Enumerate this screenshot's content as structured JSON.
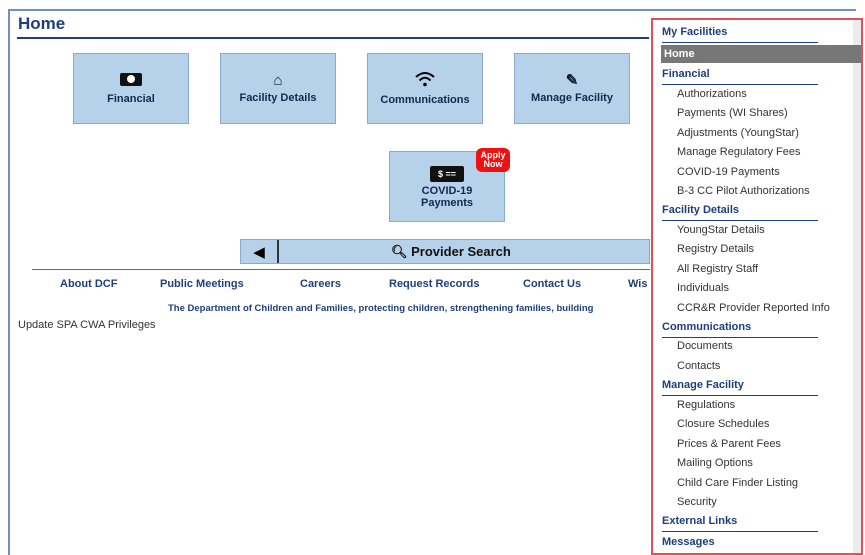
{
  "page": {
    "title": "Home"
  },
  "tiles": {
    "financial": "Financial",
    "facility_details": "Facility Details",
    "communications": "Communications",
    "manage_facility": "Manage Facility",
    "covid_line1": "COVID-19",
    "covid_line2": "Payments",
    "badge_line1": "Apply",
    "badge_line2": "Now",
    "pay_icon_text": "$ =="
  },
  "search": {
    "label": "Provider Search"
  },
  "footer": {
    "links": [
      "About DCF",
      "Public Meetings",
      "Careers",
      "Request Records",
      "Contact Us",
      "Wis"
    ],
    "tagline": "The Department of Children and Families, protecting children, strengthening families, building",
    "update_link": "Update SPA CWA Privileges"
  },
  "menu": {
    "my_facilities": "My Facilities",
    "home": "Home",
    "financial": "Financial",
    "financial_items": [
      "Authorizations",
      "Payments (WI Shares)",
      "Adjustments (YoungStar)",
      "Manage Regulatory Fees",
      "COVID-19 Payments",
      "B-3 CC Pilot Authorizations"
    ],
    "facility_details": "Facility Details",
    "facility_items": [
      "YoungStar Details",
      "Registry Details",
      "All Registry Staff",
      "Individuals",
      "CCR&R Provider Reported Info"
    ],
    "communications": "Communications",
    "communications_items": [
      "Documents",
      "Contacts"
    ],
    "manage_facility": "Manage Facility",
    "manage_items": [
      "Regulations",
      "Closure Schedules",
      "Prices & Parent Fees",
      "Mailing Options",
      "Child Care Finder Listing",
      "Security"
    ],
    "external_links": "External Links",
    "messages": "Messages"
  },
  "colors": {
    "tile_bg": "#b6d1ea",
    "heading": "#1f3f7a",
    "menu_border": "#e0505a",
    "badge": "#e11111"
  },
  "icons": {
    "financial": "money-icon",
    "facility_details": "house-icon",
    "communications": "wifi-icon",
    "manage_facility": "edit-icon",
    "covid_payments": "payment-card-icon",
    "back": "triangle-left-icon",
    "search": "search-icon"
  }
}
